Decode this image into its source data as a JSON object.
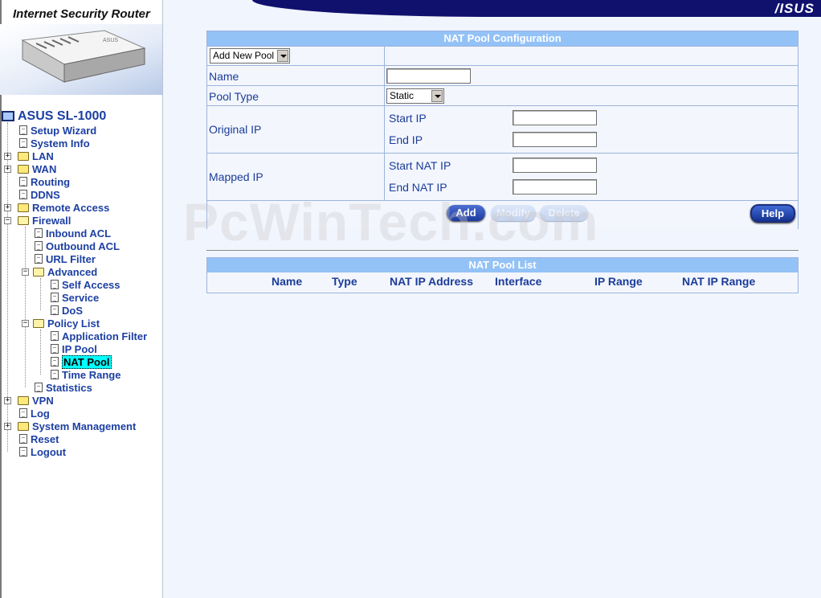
{
  "header": {
    "brand": "Internet Security Router",
    "logo_text": "/ISUS"
  },
  "tree": {
    "root": "ASUS SL-1000",
    "items": [
      "Setup Wizard",
      "System Info",
      "LAN",
      "WAN",
      "Routing",
      "DDNS",
      "Remote Access",
      "Firewall",
      "Inbound ACL",
      "Outbound ACL",
      "URL Filter",
      "Advanced",
      "Self Access",
      "Service",
      "DoS",
      "Policy List",
      "Application Filter",
      "IP Pool",
      "NAT Pool",
      "Time Range",
      "Statistics",
      "VPN",
      "Log",
      "System Management",
      "Reset",
      "Logout"
    ],
    "selected": "NAT Pool"
  },
  "config": {
    "title": "NAT Pool Configuration",
    "pool_select": "Add New Pool",
    "name_label": "Name",
    "name_value": "",
    "pool_type_label": "Pool Type",
    "pool_type_value": "Static",
    "original_ip_label": "Original IP",
    "start_ip_label": "Start IP",
    "end_ip_label": "End IP",
    "mapped_ip_label": "Mapped IP",
    "start_nat_ip_label": "Start NAT IP",
    "end_nat_ip_label": "End NAT IP",
    "buttons": {
      "add": "Add",
      "modify": "Modify",
      "delete": "Delete",
      "help": "Help"
    }
  },
  "list": {
    "title": "NAT Pool List",
    "columns": [
      "Name",
      "Type",
      "NAT IP Address",
      "Interface",
      "IP Range",
      "NAT IP Range"
    ]
  },
  "watermark": "PcWinTech.com",
  "colors": {
    "banner": "#10116d",
    "panel_header": "#93c2f7",
    "link": "#1c3fa2",
    "selected_bg": "#00ffff"
  }
}
